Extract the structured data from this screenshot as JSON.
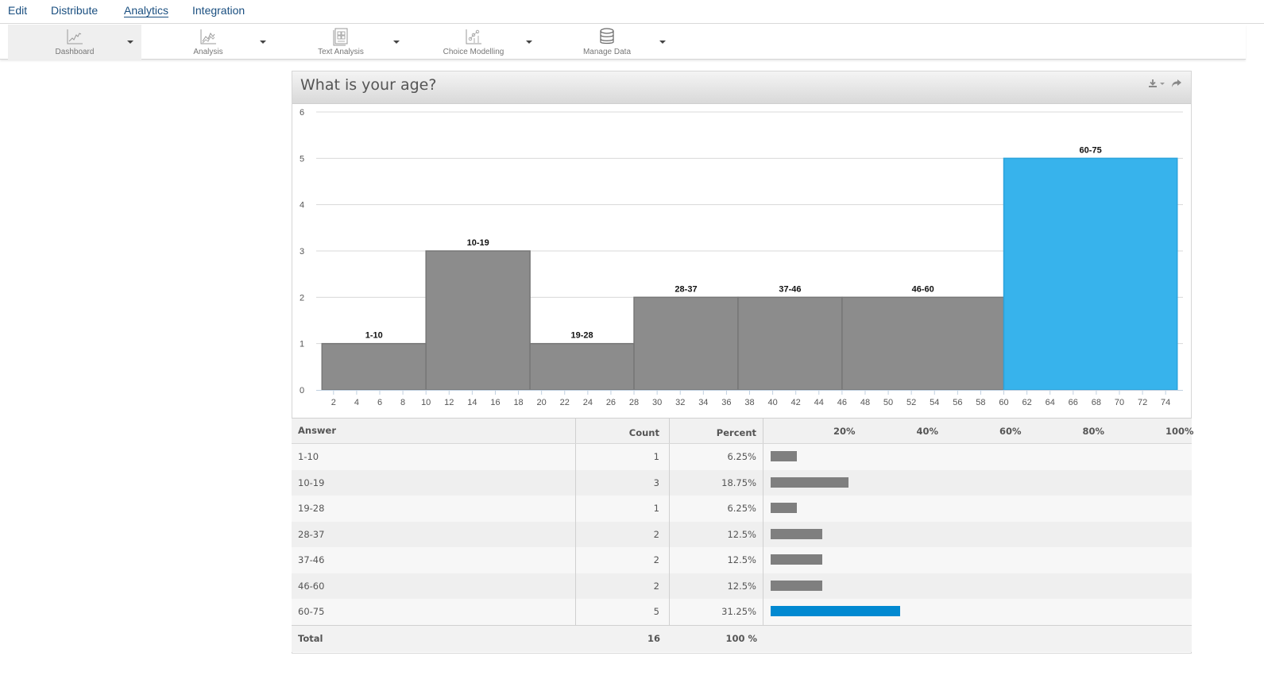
{
  "nav": {
    "items": [
      {
        "label": "Edit",
        "active": false
      },
      {
        "label": "Distribute",
        "active": false
      },
      {
        "label": "Analytics",
        "active": true
      },
      {
        "label": "Integration",
        "active": false
      }
    ]
  },
  "toolbar": {
    "items": [
      {
        "label": "Dashboard",
        "icon": "line-chart-icon",
        "active": true
      },
      {
        "label": "Analysis",
        "icon": "analysis-chart-icon",
        "active": false
      },
      {
        "label": "Text Analysis",
        "icon": "text-document-icon",
        "active": false
      },
      {
        "label": "Choice Modelling",
        "icon": "scatter-chart-icon",
        "active": false
      },
      {
        "label": "Manage Data",
        "icon": "database-icon",
        "active": false
      }
    ]
  },
  "panel": {
    "title": "What is your age?",
    "icons": [
      "download-icon",
      "chevron-down-icon",
      "share-icon"
    ]
  },
  "colors": {
    "bar_default": "#8c8c8c",
    "bar_highlight": "#37b3ec",
    "table_bar_default": "#7f7f7f",
    "table_bar_highlight": "#0289d1",
    "nav_link": "#1a4f80"
  },
  "chart_data": {
    "type": "bar",
    "subtype": "histogram",
    "title": "What is your age?",
    "xlabel": "",
    "ylabel": "",
    "xlim": [
      0.5,
      75.5
    ],
    "ylim": [
      0,
      6
    ],
    "grid": true,
    "yticks": [
      0,
      1,
      2,
      3,
      4,
      5,
      6
    ],
    "xticks": [
      2,
      4,
      6,
      8,
      10,
      12,
      14,
      16,
      18,
      20,
      22,
      24,
      26,
      28,
      30,
      32,
      34,
      36,
      38,
      40,
      42,
      44,
      46,
      48,
      50,
      52,
      54,
      56,
      58,
      60,
      62,
      64,
      66,
      68,
      70,
      72,
      74
    ],
    "bins": [
      {
        "label": "1-10",
        "start": 1,
        "end": 10,
        "value": 1,
        "highlight": false
      },
      {
        "label": "10-19",
        "start": 10,
        "end": 19,
        "value": 3,
        "highlight": false
      },
      {
        "label": "19-28",
        "start": 19,
        "end": 28,
        "value": 1,
        "highlight": false
      },
      {
        "label": "28-37",
        "start": 28,
        "end": 37,
        "value": 2,
        "highlight": false
      },
      {
        "label": "37-46",
        "start": 37,
        "end": 46,
        "value": 2,
        "highlight": false
      },
      {
        "label": "46-60",
        "start": 46,
        "end": 60,
        "value": 2,
        "highlight": false
      },
      {
        "label": "60-75",
        "start": 60,
        "end": 75,
        "value": 5,
        "highlight": true
      }
    ]
  },
  "table": {
    "headers": {
      "answer": "Answer",
      "count": "Count",
      "percent": "Percent"
    },
    "scale": [
      "20%",
      "40%",
      "60%",
      "80%",
      "100%"
    ],
    "rows": [
      {
        "answer": "1-10",
        "count": "1",
        "percent": "6.25%",
        "fraction": 0.0625,
        "highlight": false
      },
      {
        "answer": "10-19",
        "count": "3",
        "percent": "18.75%",
        "fraction": 0.1875,
        "highlight": false
      },
      {
        "answer": "19-28",
        "count": "1",
        "percent": "6.25%",
        "fraction": 0.0625,
        "highlight": false
      },
      {
        "answer": "28-37",
        "count": "2",
        "percent": "12.5%",
        "fraction": 0.125,
        "highlight": false
      },
      {
        "answer": "37-46",
        "count": "2",
        "percent": "12.5%",
        "fraction": 0.125,
        "highlight": false
      },
      {
        "answer": "46-60",
        "count": "2",
        "percent": "12.5%",
        "fraction": 0.125,
        "highlight": false
      },
      {
        "answer": "60-75",
        "count": "5",
        "percent": "31.25%",
        "fraction": 0.3125,
        "highlight": true
      }
    ],
    "total": {
      "label": "Total",
      "count": "16",
      "percent": "100 %"
    }
  }
}
